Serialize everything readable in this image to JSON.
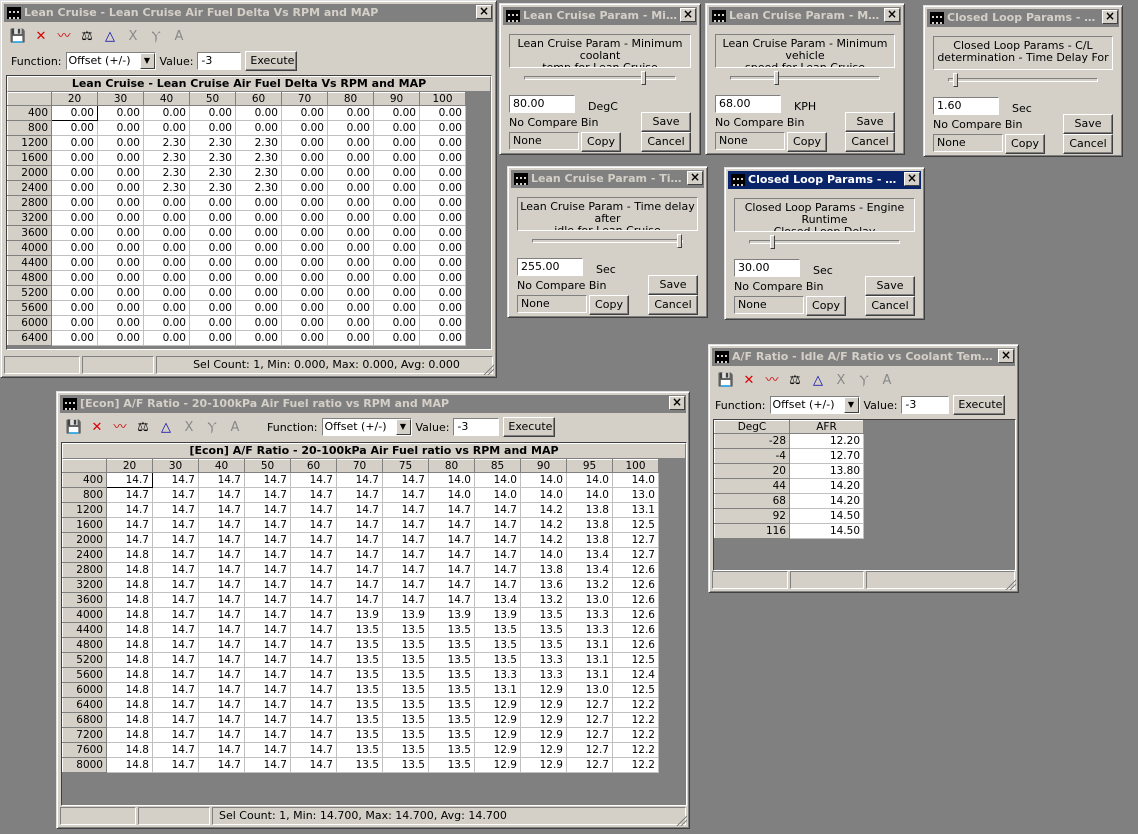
{
  "lc_table": {
    "title": "Lean Cruise - Lean Cruise Air Fuel Delta Vs RPM and MAP",
    "grid_title": "Lean Cruise - Lean Cruise Air Fuel Delta Vs RPM and MAP",
    "function_label": "Function:",
    "function_value": "Offset (+/-)",
    "value_label": "Value:",
    "value": "-3",
    "execute": "Execute",
    "cols": [
      "20",
      "30",
      "40",
      "50",
      "60",
      "70",
      "80",
      "90",
      "100"
    ],
    "rows": [
      {
        "h": "400",
        "v": [
          "0.00",
          "0.00",
          "0.00",
          "0.00",
          "0.00",
          "0.00",
          "0.00",
          "0.00",
          "0.00"
        ]
      },
      {
        "h": "800",
        "v": [
          "0.00",
          "0.00",
          "0.00",
          "0.00",
          "0.00",
          "0.00",
          "0.00",
          "0.00",
          "0.00"
        ]
      },
      {
        "h": "1200",
        "v": [
          "0.00",
          "0.00",
          "2.30",
          "2.30",
          "2.30",
          "0.00",
          "0.00",
          "0.00",
          "0.00"
        ]
      },
      {
        "h": "1600",
        "v": [
          "0.00",
          "0.00",
          "2.30",
          "2.30",
          "2.30",
          "0.00",
          "0.00",
          "0.00",
          "0.00"
        ]
      },
      {
        "h": "2000",
        "v": [
          "0.00",
          "0.00",
          "2.30",
          "2.30",
          "2.30",
          "0.00",
          "0.00",
          "0.00",
          "0.00"
        ]
      },
      {
        "h": "2400",
        "v": [
          "0.00",
          "0.00",
          "2.30",
          "2.30",
          "2.30",
          "0.00",
          "0.00",
          "0.00",
          "0.00"
        ]
      },
      {
        "h": "2800",
        "v": [
          "0.00",
          "0.00",
          "0.00",
          "0.00",
          "0.00",
          "0.00",
          "0.00",
          "0.00",
          "0.00"
        ]
      },
      {
        "h": "3200",
        "v": [
          "0.00",
          "0.00",
          "0.00",
          "0.00",
          "0.00",
          "0.00",
          "0.00",
          "0.00",
          "0.00"
        ]
      },
      {
        "h": "3600",
        "v": [
          "0.00",
          "0.00",
          "0.00",
          "0.00",
          "0.00",
          "0.00",
          "0.00",
          "0.00",
          "0.00"
        ]
      },
      {
        "h": "4000",
        "v": [
          "0.00",
          "0.00",
          "0.00",
          "0.00",
          "0.00",
          "0.00",
          "0.00",
          "0.00",
          "0.00"
        ]
      },
      {
        "h": "4400",
        "v": [
          "0.00",
          "0.00",
          "0.00",
          "0.00",
          "0.00",
          "0.00",
          "0.00",
          "0.00",
          "0.00"
        ]
      },
      {
        "h": "4800",
        "v": [
          "0.00",
          "0.00",
          "0.00",
          "0.00",
          "0.00",
          "0.00",
          "0.00",
          "0.00",
          "0.00"
        ]
      },
      {
        "h": "5200",
        "v": [
          "0.00",
          "0.00",
          "0.00",
          "0.00",
          "0.00",
          "0.00",
          "0.00",
          "0.00",
          "0.00"
        ]
      },
      {
        "h": "5600",
        "v": [
          "0.00",
          "0.00",
          "0.00",
          "0.00",
          "0.00",
          "0.00",
          "0.00",
          "0.00",
          "0.00"
        ]
      },
      {
        "h": "6000",
        "v": [
          "0.00",
          "0.00",
          "0.00",
          "0.00",
          "0.00",
          "0.00",
          "0.00",
          "0.00",
          "0.00"
        ]
      },
      {
        "h": "6400",
        "v": [
          "0.00",
          "0.00",
          "0.00",
          "0.00",
          "0.00",
          "0.00",
          "0.00",
          "0.00",
          "0.00"
        ]
      }
    ],
    "status": "Sel Count: 1, Min: 0.000, Max: 0.000, Avg: 0.000"
  },
  "params": [
    {
      "title": "Lean Cruise Param - Mini...",
      "desc1": "Lean Cruise Param - Minimum coolant",
      "desc2": "temp for Lean Cruise",
      "value": "80.00",
      "unit": "DegC",
      "compare": "No Compare Bin",
      "none": "None",
      "copy": "Copy",
      "save": "Save",
      "cancel": "Cancel"
    },
    {
      "title": "Lean Cruise Param - Mini...",
      "desc1": "Lean Cruise Param - Minimum vehicle",
      "desc2": "speed for Lean Cruise",
      "value": "68.00",
      "unit": "KPH",
      "compare": "No Compare Bin",
      "none": "None",
      "copy": "Copy",
      "save": "Save",
      "cancel": "Cancel"
    },
    {
      "title": "Closed Loop Params - C/L...",
      "desc1": "Closed Loop Params - C/L",
      "desc2": "determination - Time Delay For",
      "value": "1.60",
      "unit": "Sec",
      "compare": "No Compare Bin",
      "none": "None",
      "copy": "Copy",
      "save": "Save",
      "cancel": "Cancel"
    },
    {
      "title": "Lean Cruise Param - Time...",
      "desc1": "Lean Cruise Param - Time delay after",
      "desc2": "idle for Lean Cruise",
      "value": "255.00",
      "unit": "Sec",
      "compare": "No Compare Bin",
      "none": "None",
      "copy": "Copy",
      "save": "Save",
      "cancel": "Cancel"
    },
    {
      "title": "Closed Loop Params - Eng...",
      "desc1": "Closed Loop Params - Engine Runtime",
      "desc2": "Closed Loop Delay",
      "value": "30.00",
      "unit": "Sec",
      "compare": "No Compare Bin",
      "none": "None",
      "copy": "Copy",
      "save": "Save",
      "cancel": "Cancel"
    }
  ],
  "idle_table": {
    "title": "A/F Ratio - Idle A/F Ratio vs Coolant Temper...",
    "function_label": "Function:",
    "function_value": "Offset (+/-)",
    "value_label": "Value:",
    "value": "-3",
    "execute": "Execute",
    "col_h": "DegC",
    "col_v": "AFR",
    "rows": [
      {
        "h": "-28",
        "v": "12.20"
      },
      {
        "h": "-4",
        "v": "12.70"
      },
      {
        "h": "20",
        "v": "13.80"
      },
      {
        "h": "44",
        "v": "14.20"
      },
      {
        "h": "68",
        "v": "14.20"
      },
      {
        "h": "92",
        "v": "14.50"
      },
      {
        "h": "116",
        "v": "14.50"
      }
    ]
  },
  "econ_table": {
    "title": "[Econ] A/F Ratio - 20-100kPa Air Fuel ratio vs RPM and MAP",
    "grid_title": "[Econ] A/F Ratio - 20-100kPa Air Fuel ratio vs RPM and MAP",
    "function_label": "Function:",
    "function_value": "Offset (+/-)",
    "value_label": "Value:",
    "value": "-3",
    "execute": "Execute",
    "cols": [
      "20",
      "30",
      "40",
      "50",
      "60",
      "70",
      "75",
      "80",
      "85",
      "90",
      "95",
      "100"
    ],
    "rows": [
      {
        "h": "400",
        "v": [
          "14.7",
          "14.7",
          "14.7",
          "14.7",
          "14.7",
          "14.7",
          "14.7",
          "14.0",
          "14.0",
          "14.0",
          "14.0",
          "14.0"
        ]
      },
      {
        "h": "800",
        "v": [
          "14.7",
          "14.7",
          "14.7",
          "14.7",
          "14.7",
          "14.7",
          "14.7",
          "14.0",
          "14.0",
          "14.0",
          "14.0",
          "13.0"
        ]
      },
      {
        "h": "1200",
        "v": [
          "14.7",
          "14.7",
          "14.7",
          "14.7",
          "14.7",
          "14.7",
          "14.7",
          "14.7",
          "14.7",
          "14.2",
          "13.8",
          "13.1"
        ]
      },
      {
        "h": "1600",
        "v": [
          "14.7",
          "14.7",
          "14.7",
          "14.7",
          "14.7",
          "14.7",
          "14.7",
          "14.7",
          "14.7",
          "14.2",
          "13.8",
          "12.5"
        ]
      },
      {
        "h": "2000",
        "v": [
          "14.7",
          "14.7",
          "14.7",
          "14.7",
          "14.7",
          "14.7",
          "14.7",
          "14.7",
          "14.7",
          "14.2",
          "13.8",
          "12.7"
        ]
      },
      {
        "h": "2400",
        "v": [
          "14.8",
          "14.7",
          "14.7",
          "14.7",
          "14.7",
          "14.7",
          "14.7",
          "14.7",
          "14.7",
          "14.0",
          "13.4",
          "12.7"
        ]
      },
      {
        "h": "2800",
        "v": [
          "14.8",
          "14.7",
          "14.7",
          "14.7",
          "14.7",
          "14.7",
          "14.7",
          "14.7",
          "14.7",
          "13.8",
          "13.4",
          "12.6"
        ]
      },
      {
        "h": "3200",
        "v": [
          "14.8",
          "14.7",
          "14.7",
          "14.7",
          "14.7",
          "14.7",
          "14.7",
          "14.7",
          "14.7",
          "13.6",
          "13.2",
          "12.6"
        ]
      },
      {
        "h": "3600",
        "v": [
          "14.8",
          "14.7",
          "14.7",
          "14.7",
          "14.7",
          "14.7",
          "14.7",
          "14.7",
          "13.4",
          "13.2",
          "13.0",
          "12.6"
        ]
      },
      {
        "h": "4000",
        "v": [
          "14.8",
          "14.7",
          "14.7",
          "14.7",
          "14.7",
          "13.9",
          "13.9",
          "13.9",
          "13.9",
          "13.5",
          "13.3",
          "12.6"
        ]
      },
      {
        "h": "4400",
        "v": [
          "14.8",
          "14.7",
          "14.7",
          "14.7",
          "14.7",
          "13.5",
          "13.5",
          "13.5",
          "13.5",
          "13.5",
          "13.3",
          "12.6"
        ]
      },
      {
        "h": "4800",
        "v": [
          "14.8",
          "14.7",
          "14.7",
          "14.7",
          "14.7",
          "13.5",
          "13.5",
          "13.5",
          "13.5",
          "13.5",
          "13.1",
          "12.6"
        ]
      },
      {
        "h": "5200",
        "v": [
          "14.8",
          "14.7",
          "14.7",
          "14.7",
          "14.7",
          "13.5",
          "13.5",
          "13.5",
          "13.5",
          "13.3",
          "13.1",
          "12.5"
        ]
      },
      {
        "h": "5600",
        "v": [
          "14.8",
          "14.7",
          "14.7",
          "14.7",
          "14.7",
          "13.5",
          "13.5",
          "13.5",
          "13.3",
          "13.3",
          "13.1",
          "12.4"
        ]
      },
      {
        "h": "6000",
        "v": [
          "14.8",
          "14.7",
          "14.7",
          "14.7",
          "14.7",
          "13.5",
          "13.5",
          "13.5",
          "13.1",
          "12.9",
          "13.0",
          "12.5"
        ]
      },
      {
        "h": "6400",
        "v": [
          "14.8",
          "14.7",
          "14.7",
          "14.7",
          "14.7",
          "13.5",
          "13.5",
          "13.5",
          "12.9",
          "12.9",
          "12.7",
          "12.2"
        ]
      },
      {
        "h": "6800",
        "v": [
          "14.8",
          "14.7",
          "14.7",
          "14.7",
          "14.7",
          "13.5",
          "13.5",
          "13.5",
          "12.9",
          "12.9",
          "12.7",
          "12.2"
        ]
      },
      {
        "h": "7200",
        "v": [
          "14.8",
          "14.7",
          "14.7",
          "14.7",
          "14.7",
          "13.5",
          "13.5",
          "13.5",
          "12.9",
          "12.9",
          "12.7",
          "12.2"
        ]
      },
      {
        "h": "7600",
        "v": [
          "14.8",
          "14.7",
          "14.7",
          "14.7",
          "14.7",
          "13.5",
          "13.5",
          "13.5",
          "12.9",
          "12.9",
          "12.7",
          "12.2"
        ]
      },
      {
        "h": "8000",
        "v": [
          "14.8",
          "14.7",
          "14.7",
          "14.7",
          "14.7",
          "13.5",
          "13.5",
          "13.5",
          "12.9",
          "12.9",
          "12.7",
          "12.2"
        ]
      }
    ],
    "status": "Sel Count: 1, Min: 14.700, Max: 14.700, Avg: 14.700"
  },
  "toolbar_icons": [
    "save-icon",
    "delete-icon",
    "graph-icon",
    "scale-icon",
    "triangle-icon",
    "x-axis-icon",
    "y-axis-icon",
    "font-icon"
  ]
}
